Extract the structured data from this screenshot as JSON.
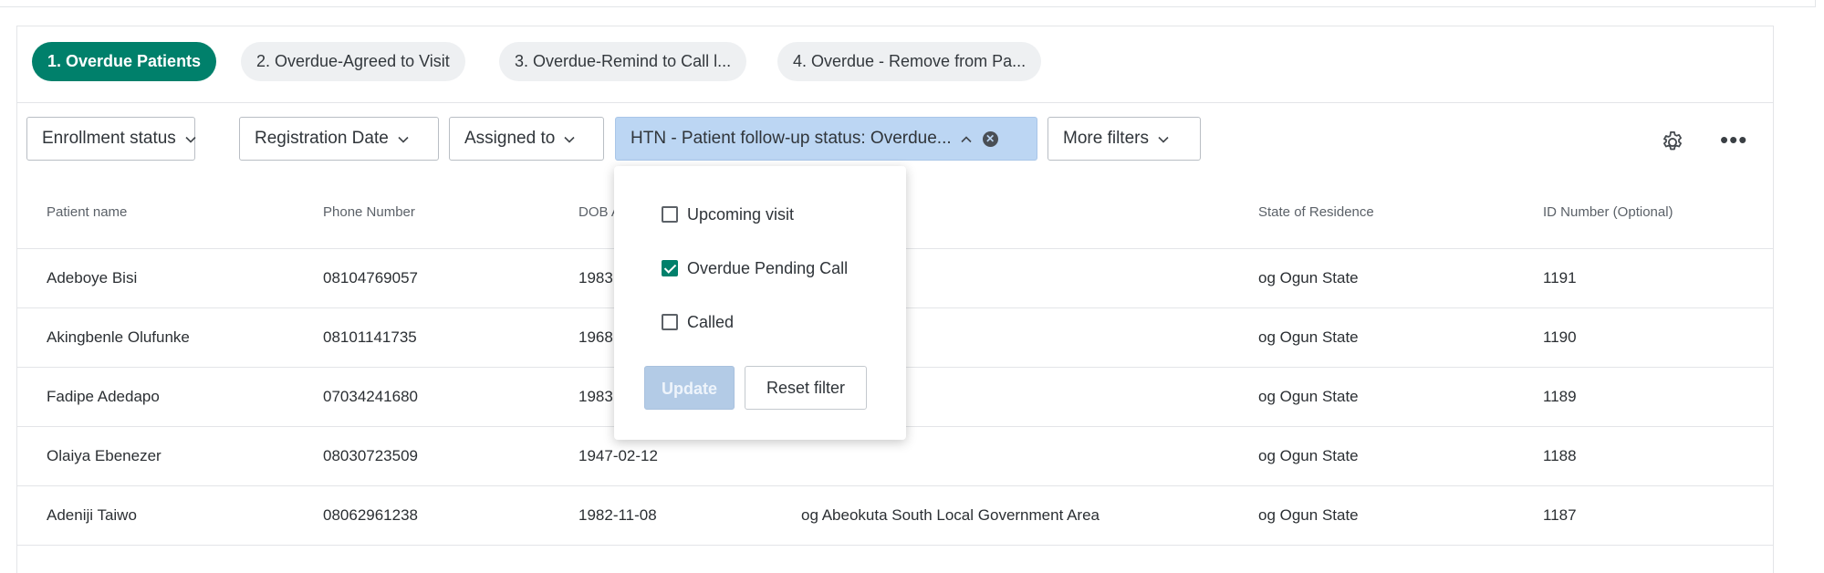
{
  "tabs": [
    {
      "label": "1. Overdue Patients"
    },
    {
      "label": "2. Overdue-Agreed to Visit"
    },
    {
      "label": "3. Overdue-Remind to Call l..."
    },
    {
      "label": "4. Overdue - Remove from Pa..."
    }
  ],
  "filters": {
    "enrollment": "Enrollment status",
    "registration": "Registration Date",
    "assigned": "Assigned to",
    "htn": "HTN - Patient follow-up status: Overdue...",
    "more": "More filters"
  },
  "columns": [
    "Patient name",
    "Phone Number",
    "DOB A",
    "State of Residence",
    "ID Number (Optional)"
  ],
  "rows": [
    {
      "name": "Adeboye Bisi",
      "phone": "08104769057",
      "dob": "1983",
      "lga": "",
      "state": "og Ogun State",
      "id": "1191"
    },
    {
      "name": "Akingbenle Olufunke",
      "phone": "08101141735",
      "dob": "1968",
      "lga": "",
      "state": "og Ogun State",
      "id": "1190"
    },
    {
      "name": "Fadipe Adedapo",
      "phone": "07034241680",
      "dob": "1983",
      "lga": "",
      "state": "og Ogun State",
      "id": "1189"
    },
    {
      "name": "Olaiya Ebenezer",
      "phone": "08030723509",
      "dob": "1947-02-12",
      "lga": "",
      "state": "og Ogun State",
      "id": "1188"
    },
    {
      "name": "Adeniji Taiwo",
      "phone": "08062961238",
      "dob": "1982-11-08",
      "lga": "og Abeokuta South Local Government Area",
      "state": "og Ogun State",
      "id": "1187"
    }
  ],
  "popup": {
    "options": [
      {
        "label": "Upcoming visit",
        "checked": false
      },
      {
        "label": "Overdue Pending Call",
        "checked": true
      },
      {
        "label": "Called",
        "checked": false
      }
    ],
    "update_label": "Update",
    "reset_label": "Reset filter"
  },
  "colors": {
    "accent": "#00806b",
    "active_filter": "#bcd6f3"
  }
}
